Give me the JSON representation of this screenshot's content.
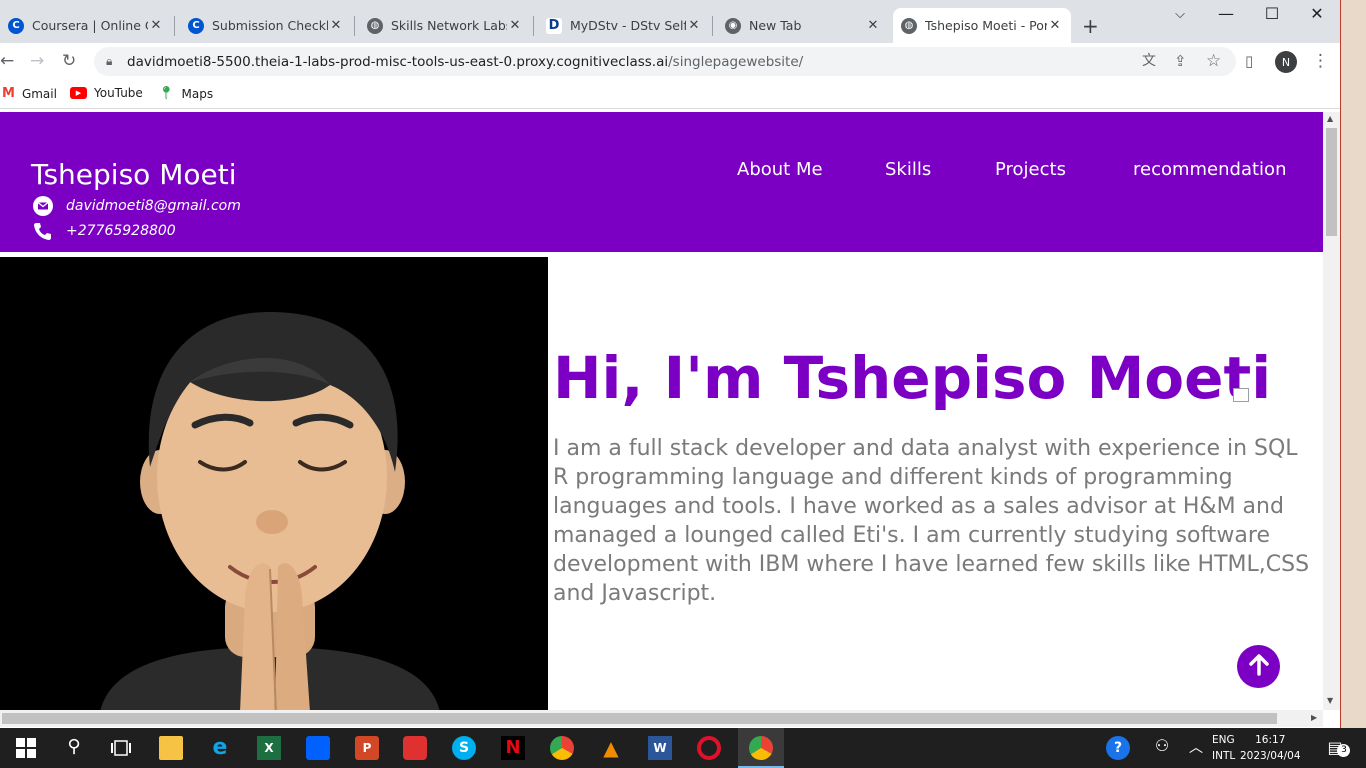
{
  "browser": {
    "tabs": [
      {
        "title": "Coursera | Online Cou",
        "favicon": "coursera-icon"
      },
      {
        "title": "Submission Checklist",
        "favicon": "coursera-icon"
      },
      {
        "title": "Skills Network Labs",
        "favicon": "globe-icon"
      },
      {
        "title": "MyDStv - DStv Self Se",
        "favicon": "dstv-icon"
      },
      {
        "title": "New Tab",
        "favicon": "chrome-icon"
      },
      {
        "title": "Tshepiso Moeti - Port",
        "favicon": "globe-icon",
        "active": true
      }
    ],
    "url_host": "davidmoeti8-5500.theia-1-labs-prod-misc-tools-us-east-0.proxy.cognitiveclass.ai",
    "url_path": "/singlepagewebsite/",
    "profile_initial": "N",
    "bookmarks": [
      {
        "label": "Gmail",
        "icon": "gmail-icon"
      },
      {
        "label": "YouTube",
        "icon": "youtube-icon"
      },
      {
        "label": "Maps",
        "icon": "maps-icon"
      }
    ]
  },
  "site": {
    "name": "Tshepiso Moeti",
    "email": "davidmoeti8@gmail.com",
    "phone": "+27765928800",
    "nav": [
      "About Me",
      "Skills",
      "Projects",
      "recommendation"
    ],
    "hero_title": "Hi, I'm Tshepiso Moeti",
    "hero_text": "I am a full stack developer and data analyst with experience in SQL R programming language and different kinds of programming languages and tools. I have worked as a sales advisor at H&M and managed a lounged called Eti's. I am currently studying software development with IBM where I have learned few skills like HTML,CSS and Javascript.",
    "accent_color": "#7b00c3"
  },
  "taskbar": {
    "lang_line1": "ENG",
    "lang_line2": "INTL",
    "time": "16:17",
    "date": "2023/04/04",
    "notification_count": "3"
  }
}
